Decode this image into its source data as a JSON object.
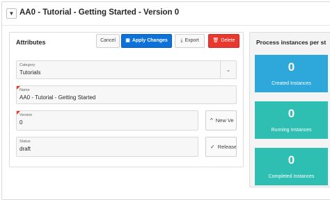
{
  "region": {
    "title": "AA0 - Tutorial - Getting Started - Version 0",
    "collapse_icon": "triangle-down"
  },
  "attributes": {
    "title": "Attributes",
    "buttons": {
      "cancel": "Cancel",
      "apply": "Apply Changes",
      "export": "Export",
      "delete": "Delete"
    },
    "fields": {
      "category": {
        "label": "Category",
        "value": "Tutorials"
      },
      "name": {
        "label": "Name",
        "value": "AA0 - Tutorial - Getting Started"
      },
      "version": {
        "label": "Version",
        "value": "0"
      },
      "status": {
        "label": "Status",
        "value": "draft"
      }
    },
    "side_buttons": {
      "new_version": "New Ve",
      "release": "Release"
    }
  },
  "process_instances": {
    "title": "Process instances per st",
    "tiles": [
      {
        "count": "0",
        "label": "Created Instances",
        "color": "#2ea8da"
      },
      {
        "count": "0",
        "label": "Running Instances",
        "color": "#2fbfb2"
      },
      {
        "count": "0",
        "label": "Completed Instances",
        "color": "#2fbfb2"
      }
    ]
  }
}
